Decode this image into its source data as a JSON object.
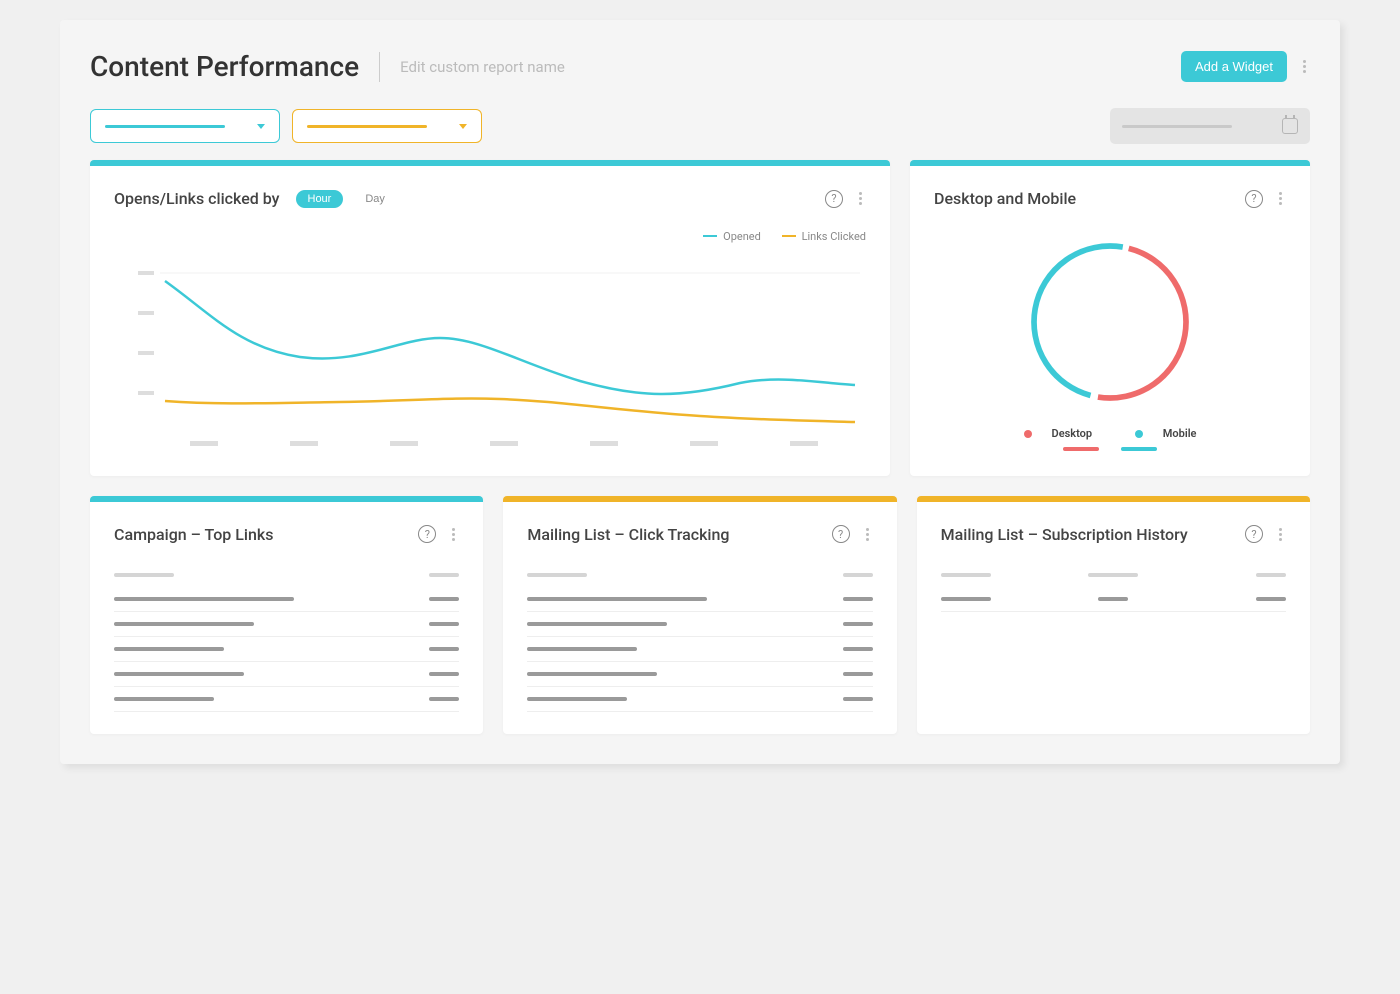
{
  "header": {
    "title": "Content Performance",
    "subtitle": "Edit custom report name",
    "add_widget_label": "Add a Widget"
  },
  "filters": {
    "primary_color": "#3cc9d6",
    "secondary_color": "#f0b429"
  },
  "cards": {
    "opens_links": {
      "title": "Opens/Links clicked by",
      "toggle_hour": "Hour",
      "toggle_day": "Day",
      "legend_opened": "Opened",
      "legend_links": "Links Clicked"
    },
    "desktop_mobile": {
      "title": "Desktop and Mobile",
      "legend_desktop": "Desktop",
      "legend_mobile": "Mobile"
    },
    "top_links": {
      "title": "Campaign – Top Links"
    },
    "click_tracking": {
      "title": "Mailing List – Click Tracking"
    },
    "subscription_history": {
      "title": "Mailing List – Subscription History"
    }
  },
  "chart_data": [
    {
      "type": "line",
      "card": "opens_links",
      "x": [
        0,
        1,
        2,
        3,
        4,
        5,
        6,
        7
      ],
      "series": [
        {
          "name": "Opened",
          "color": "#3cc9d6",
          "values": [
            95,
            52,
            40,
            47,
            38,
            25,
            22,
            28
          ]
        },
        {
          "name": "Links Clicked",
          "color": "#f0b429",
          "values": [
            22,
            20,
            21,
            22,
            23,
            18,
            14,
            13
          ]
        }
      ],
      "ylim": [
        0,
        100
      ]
    },
    {
      "type": "pie",
      "card": "desktop_mobile",
      "series": [
        {
          "name": "Desktop",
          "color": "#ef6b6b",
          "value": 50
        },
        {
          "name": "Mobile",
          "color": "#3cc9d6",
          "value": 50
        }
      ]
    }
  ]
}
